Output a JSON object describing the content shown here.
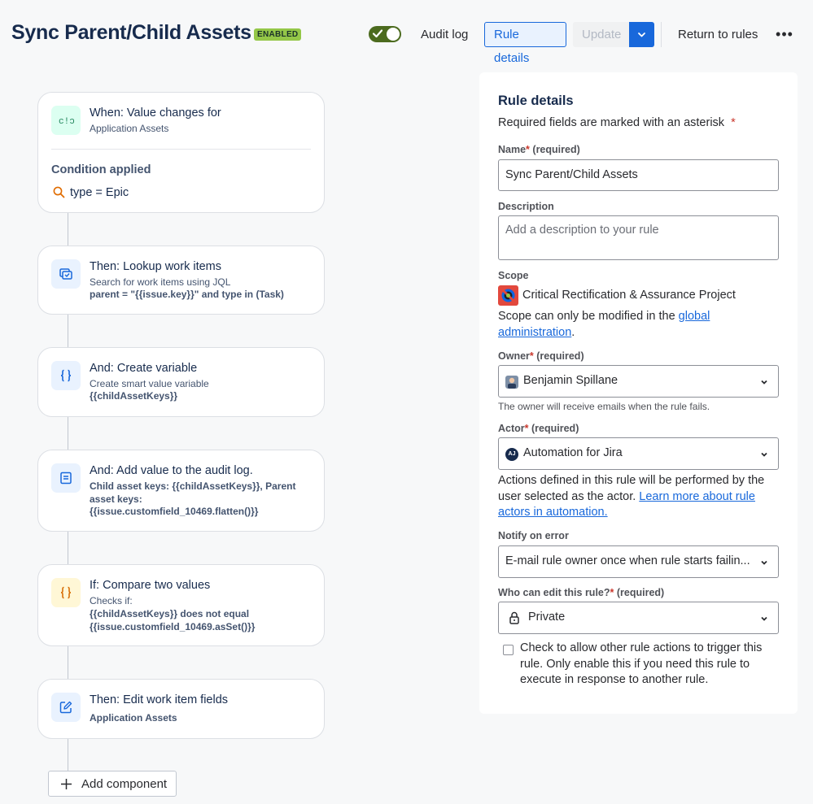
{
  "header": {
    "title": "Sync Parent/Child Assets",
    "status_badge": "ENABLED",
    "toggle_on": true,
    "audit_log": "Audit log",
    "rule_details": "Rule details",
    "update": "Update",
    "return_to_rules": "Return to rules",
    "more": "•••"
  },
  "flow": {
    "trigger": {
      "title": "When: Value changes for",
      "subtitle": "Application Assets",
      "condition_label": "Condition applied",
      "condition": "type = Epic"
    },
    "steps": [
      {
        "title": "Then: Lookup work items",
        "line1": "Search for work items using JQL",
        "line2": "parent = \"{{issue.key}}\" and type in (Task)",
        "icon": "lookup-icon"
      },
      {
        "title": "And: Create variable",
        "line1": "Create smart value variable",
        "line2": "{{childAssetKeys}}",
        "icon": "braces-icon"
      },
      {
        "title": "And: Add value to the audit log.",
        "line1": "Child asset keys: {{childAssetKeys}}, Parent asset keys: {{issue.customfield_10469.flatten()}}",
        "icon": "log-icon"
      },
      {
        "title": "If: Compare two values",
        "line1": "Checks if:",
        "line2": "{{childAssetKeys}} does not equal {{issue.customfield_10469.asSet()}}",
        "icon": "braces-icon"
      },
      {
        "title": "Then: Edit work item fields",
        "line2": "Application Assets",
        "icon": "edit-icon"
      }
    ],
    "add_component": "Add component"
  },
  "panel": {
    "title": "Rule details",
    "required_note": "Required fields are marked with an asterisk",
    "asterisk": "*",
    "name_label": "Name",
    "required_hint": "(required)",
    "name_value": "Sync Parent/Child Assets",
    "description_label": "Description",
    "description_placeholder": "Add a description to your rule",
    "scope_label": "Scope",
    "scope_value": "Critical Rectification & Assurance Project",
    "scope_note_prefix": "Scope can only be modified in the ",
    "scope_note_link": "global administration",
    "scope_note_suffix": ".",
    "owner_label": "Owner",
    "owner_value": "Benjamin Spillane",
    "owner_help": "The owner will receive emails when the rule fails.",
    "actor_label": "Actor",
    "actor_value": "Automation for Jira",
    "actor_icon_text": "AJ",
    "actor_note": "Actions defined in this rule will be performed by the user selected as the actor. ",
    "actor_note_link": "Learn more about rule actors in automation.",
    "notify_label": "Notify on error",
    "notify_value": "E-mail rule owner once when rule starts failin...",
    "who_edit_label": "Who can edit this rule?",
    "who_edit_value": "Private",
    "allow_trigger_checked": false,
    "allow_trigger_text": "Check to allow other rule actions to trigger this rule. Only enable this if you need this rule to execute in response to another rule."
  },
  "colors": {
    "accent": "#1868db",
    "enabled_badge": "#94c748",
    "toggle": "#4c6b1f",
    "required": "#c9372c"
  }
}
